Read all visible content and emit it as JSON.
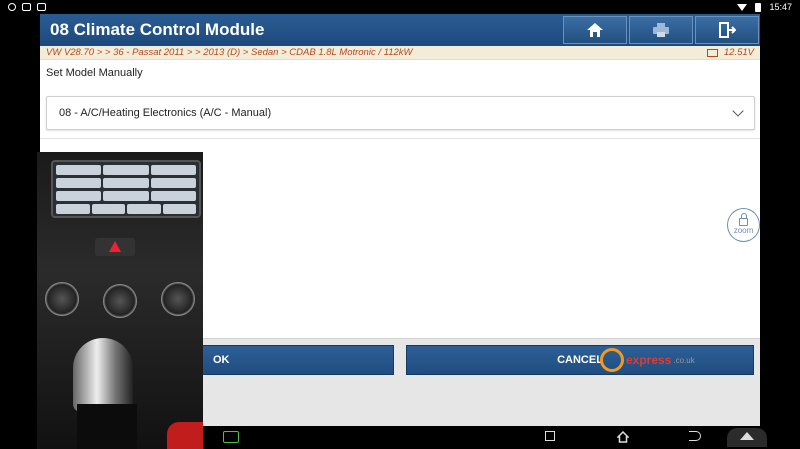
{
  "status_bar": {
    "time": "15:47"
  },
  "header": {
    "title": "08 Climate Control Module",
    "home_icon": "home-icon",
    "print_icon": "print-icon",
    "exit_icon": "exit-icon"
  },
  "breadcrumb": {
    "path": "VW V28.70 >  > 36 - Passat 2011 > > 2013 (D) > Sedan > CDAB 1.8L Motronic / 112kW",
    "voltage": "12.51V"
  },
  "main": {
    "section_label": "Set Model Manually",
    "selected_option": "08 - A/C/Heating Electronics (A/C - Manual)"
  },
  "zoom": {
    "label": "zoom"
  },
  "footer": {
    "ok_label": "OK",
    "cancel_label": "CANCEL"
  },
  "watermark": {
    "brand": "express",
    "domain": ".co.uk"
  },
  "colors": {
    "header_blue": "#1d4a7c",
    "breadcrumb_text": "#b34a1f",
    "button_blue": "#2d5f96"
  }
}
